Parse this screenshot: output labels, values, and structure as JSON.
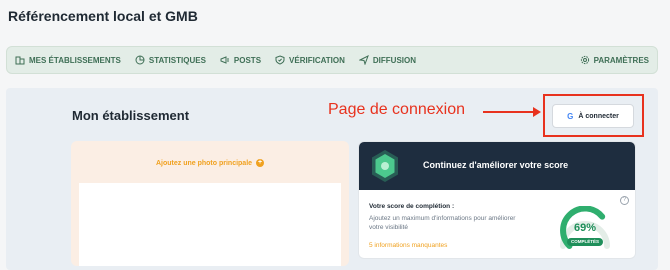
{
  "header": {
    "title": "Référencement local et GMB"
  },
  "nav": {
    "items": [
      {
        "label": "MES ÉTABLISSEMENTS",
        "icon": "building-icon"
      },
      {
        "label": "STATISTIQUES",
        "icon": "pie-chart-icon"
      },
      {
        "label": "POSTS",
        "icon": "megaphone-icon"
      },
      {
        "label": "VÉRIFICATION",
        "icon": "shield-check-icon"
      },
      {
        "label": "DIFFUSION",
        "icon": "send-icon"
      }
    ],
    "settings_label": "PARAMÈTRES"
  },
  "main": {
    "section_title": "Mon établissement",
    "connect_button": {
      "label": "À connecter",
      "icon": "google-icon"
    },
    "annotation": {
      "text": "Page de connexion",
      "color": "#e8321e"
    },
    "photo_card": {
      "link_label": "Ajoutez une photo principale"
    },
    "score_card": {
      "title": "Continuez d'améliorer votre score",
      "subtitle": "Votre score de complétion :",
      "description": "Ajoutez un maximum d'informations pour améliorer votre visibilité",
      "missing": "5 informations manquantes",
      "percent_label": "69%",
      "percent_value": 69,
      "status_badge": "COMPLÉTÉS",
      "info_symbol": "?"
    }
  },
  "colors": {
    "accent": "#3f6f56",
    "warning": "#f0a11f",
    "success": "#1f8f5a",
    "dark": "#1e2d3f"
  }
}
